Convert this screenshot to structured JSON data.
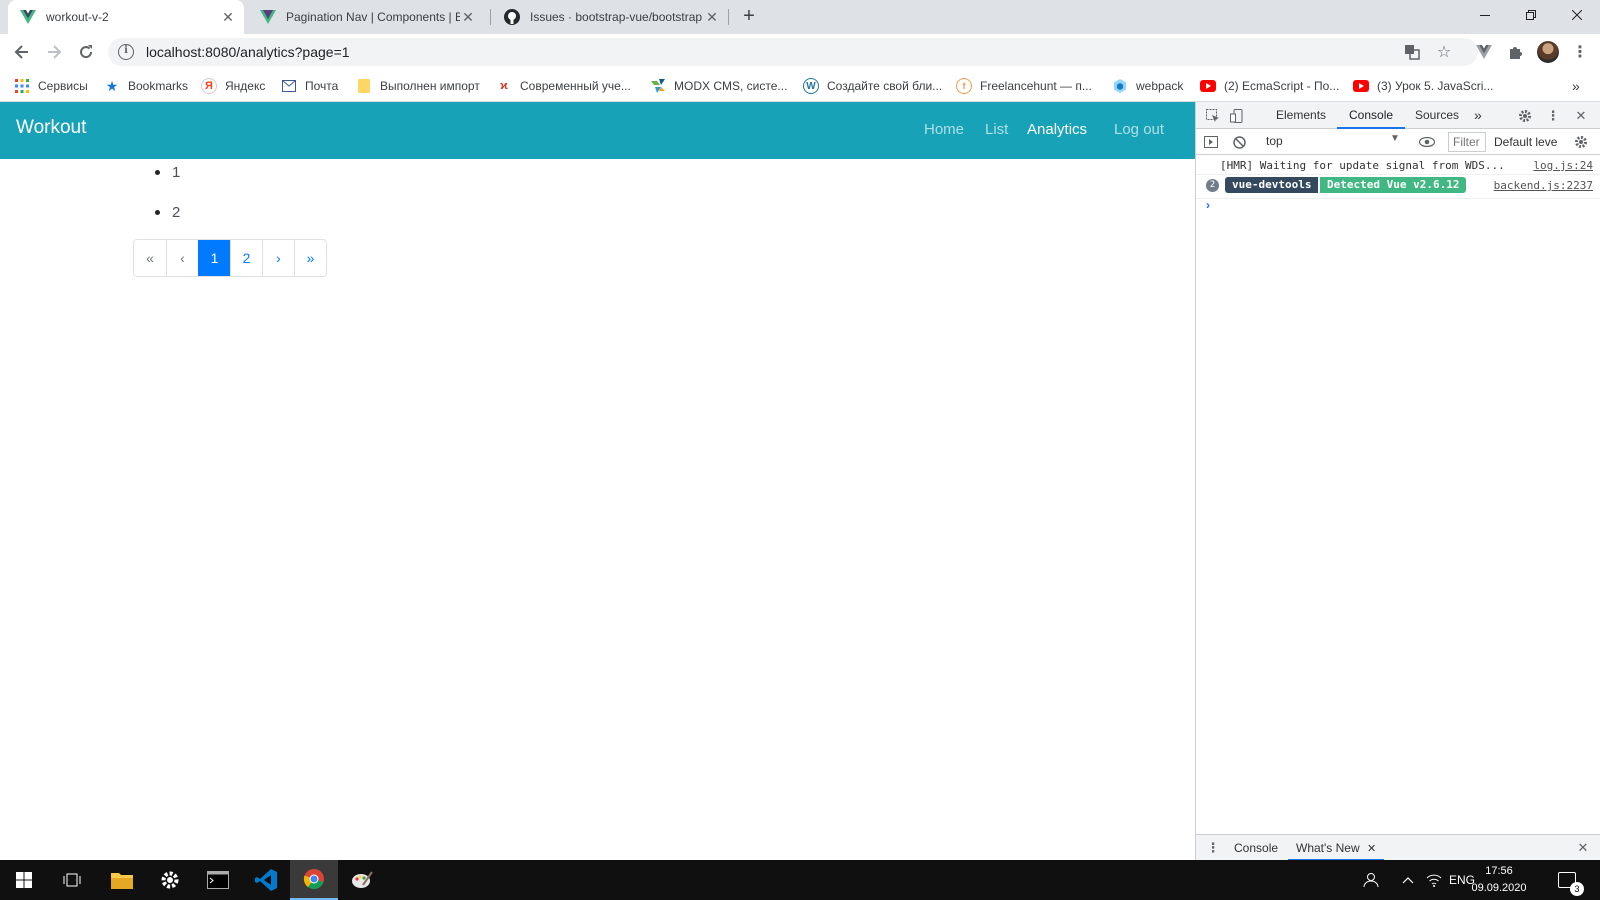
{
  "browser": {
    "tabs": [
      {
        "title": "workout-v-2",
        "active": true,
        "favicon": "vue-icon"
      },
      {
        "title": "Pagination Nav | Components | B",
        "active": false,
        "favicon": "bootstrap-vue-icon"
      },
      {
        "title": "Issues · bootstrap-vue/bootstrap",
        "active": false,
        "favicon": "github-icon"
      }
    ],
    "new_tab": "+",
    "url": "localhost:8080/analytics?page=1",
    "bookmarks": [
      {
        "label": "Сервисы",
        "icon": "apps-grid-icon"
      },
      {
        "label": "Bookmarks",
        "icon": "star-icon"
      },
      {
        "label": "Яндекс",
        "icon": "yandex-icon"
      },
      {
        "label": "Почта",
        "icon": "mail-icon"
      },
      {
        "label": "Выполнен импорт",
        "icon": "folder-icon"
      },
      {
        "label": "Современный уче...",
        "icon": "site-icon"
      },
      {
        "label": "MODX CMS, систе...",
        "icon": "modx-icon"
      },
      {
        "label": "Создайте свой бли...",
        "icon": "wordpress-icon"
      },
      {
        "label": "Freelancehunt — п...",
        "icon": "freelancehunt-icon"
      },
      {
        "label": "webpack",
        "icon": "webpack-icon"
      },
      {
        "label": "(2) EcmaScript - По...",
        "icon": "youtube-icon"
      },
      {
        "label": "(3) Урок 5. JavaScri...",
        "icon": "youtube-icon"
      }
    ],
    "bookmarks_more": "»"
  },
  "page": {
    "brand": "Workout",
    "nav": [
      {
        "label": "Home",
        "active": false
      },
      {
        "label": "List",
        "active": false
      },
      {
        "label": "Analytics",
        "active": true
      },
      {
        "label": "Log out",
        "active": false
      }
    ],
    "list_items": [
      "1",
      "2"
    ],
    "pagination": [
      {
        "label": "«",
        "state": "disabled"
      },
      {
        "label": "‹",
        "state": "disabled"
      },
      {
        "label": "1",
        "state": "active"
      },
      {
        "label": "2",
        "state": "normal"
      },
      {
        "label": "›",
        "state": "normal"
      },
      {
        "label": "»",
        "state": "normal"
      }
    ]
  },
  "devtools": {
    "tabs": [
      {
        "label": "Elements",
        "active": false
      },
      {
        "label": "Console",
        "active": true
      },
      {
        "label": "Sources",
        "active": false
      }
    ],
    "more": "»",
    "context": "top",
    "filter_placeholder": "Filter",
    "levels": "Default leve",
    "messages": [
      {
        "text": "[HMR] Waiting for update signal from WDS...",
        "source": "log.js:24"
      },
      {
        "count": "2",
        "label1": "vue-devtools",
        "label2": "Detected Vue v2.6.12",
        "source": "backend.js:2237"
      }
    ],
    "prompt": "›",
    "drawer_tabs": [
      {
        "label": "Console",
        "active": false
      },
      {
        "label": "What's New",
        "active": true
      }
    ]
  },
  "taskbar": {
    "lang": "ENG",
    "time": "17:56",
    "date": "09.09.2020",
    "notifications": "3"
  },
  "colors": {
    "navbar": "#17a2b8",
    "primary": "#007bff",
    "vue_green": "#41b883",
    "vue_dark": "#35495e"
  }
}
